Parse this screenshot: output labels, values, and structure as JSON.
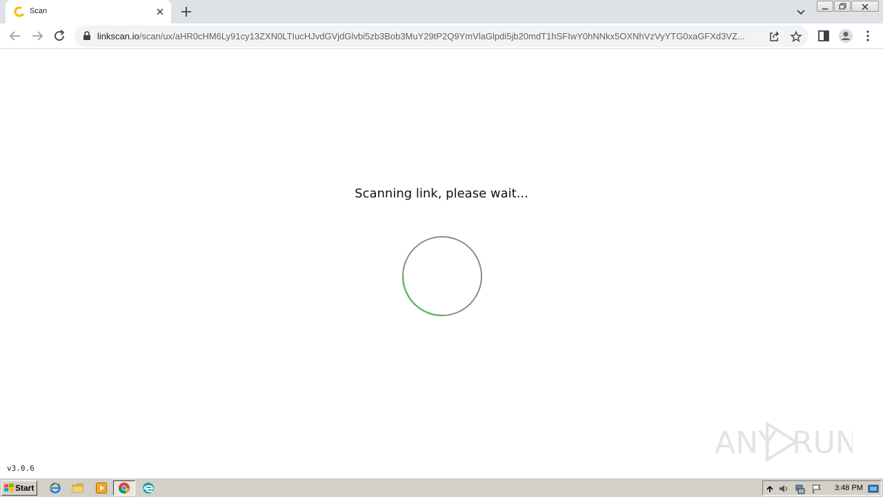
{
  "browser": {
    "tab": {
      "title": "Scan"
    },
    "address": {
      "host": "linkscan.io",
      "path": "/scan/ux/aHR0cHM6Ly91cy13ZXN0LTIucHJvdGVjdGlvbi5zb3Bob3MuY29tP2Q9YmVlaGlpdi5jb20mdT1hSFIwY0hNNkx5OXNhVzVyYTG0xaGFXd3VZ..."
    },
    "icons": {
      "favicon": "linkscan-favicon-icon",
      "close": "close-icon",
      "new_tab": "plus-icon",
      "tab_search": "chevron-down-icon",
      "back": "back-arrow-icon",
      "forward": "forward-arrow-icon",
      "reload": "reload-icon",
      "lock": "lock-icon",
      "share": "share-icon",
      "bookmark": "star-icon",
      "side_panel": "side-panel-icon",
      "profile": "profile-icon",
      "menu": "kebab-menu-icon"
    },
    "accent": "#fbbc04"
  },
  "page": {
    "message": "Scanning link, please wait...",
    "version": "v3.0.6",
    "spinner_color": "#5cb85c",
    "spinner_track_color": "#8a8a8a"
  },
  "watermark": {
    "text": "ANY RUN"
  },
  "taskbar": {
    "start_label": "Start",
    "clock": "3:48 PM",
    "icons": [
      "ie-icon",
      "explorer-folder-icon",
      "media-player-icon",
      "chrome-icon",
      "edge-icon"
    ],
    "tray_icons": [
      "expand-tray-icon",
      "volume-icon",
      "network-icon",
      "flag-icon",
      "show-desktop-icon"
    ]
  }
}
